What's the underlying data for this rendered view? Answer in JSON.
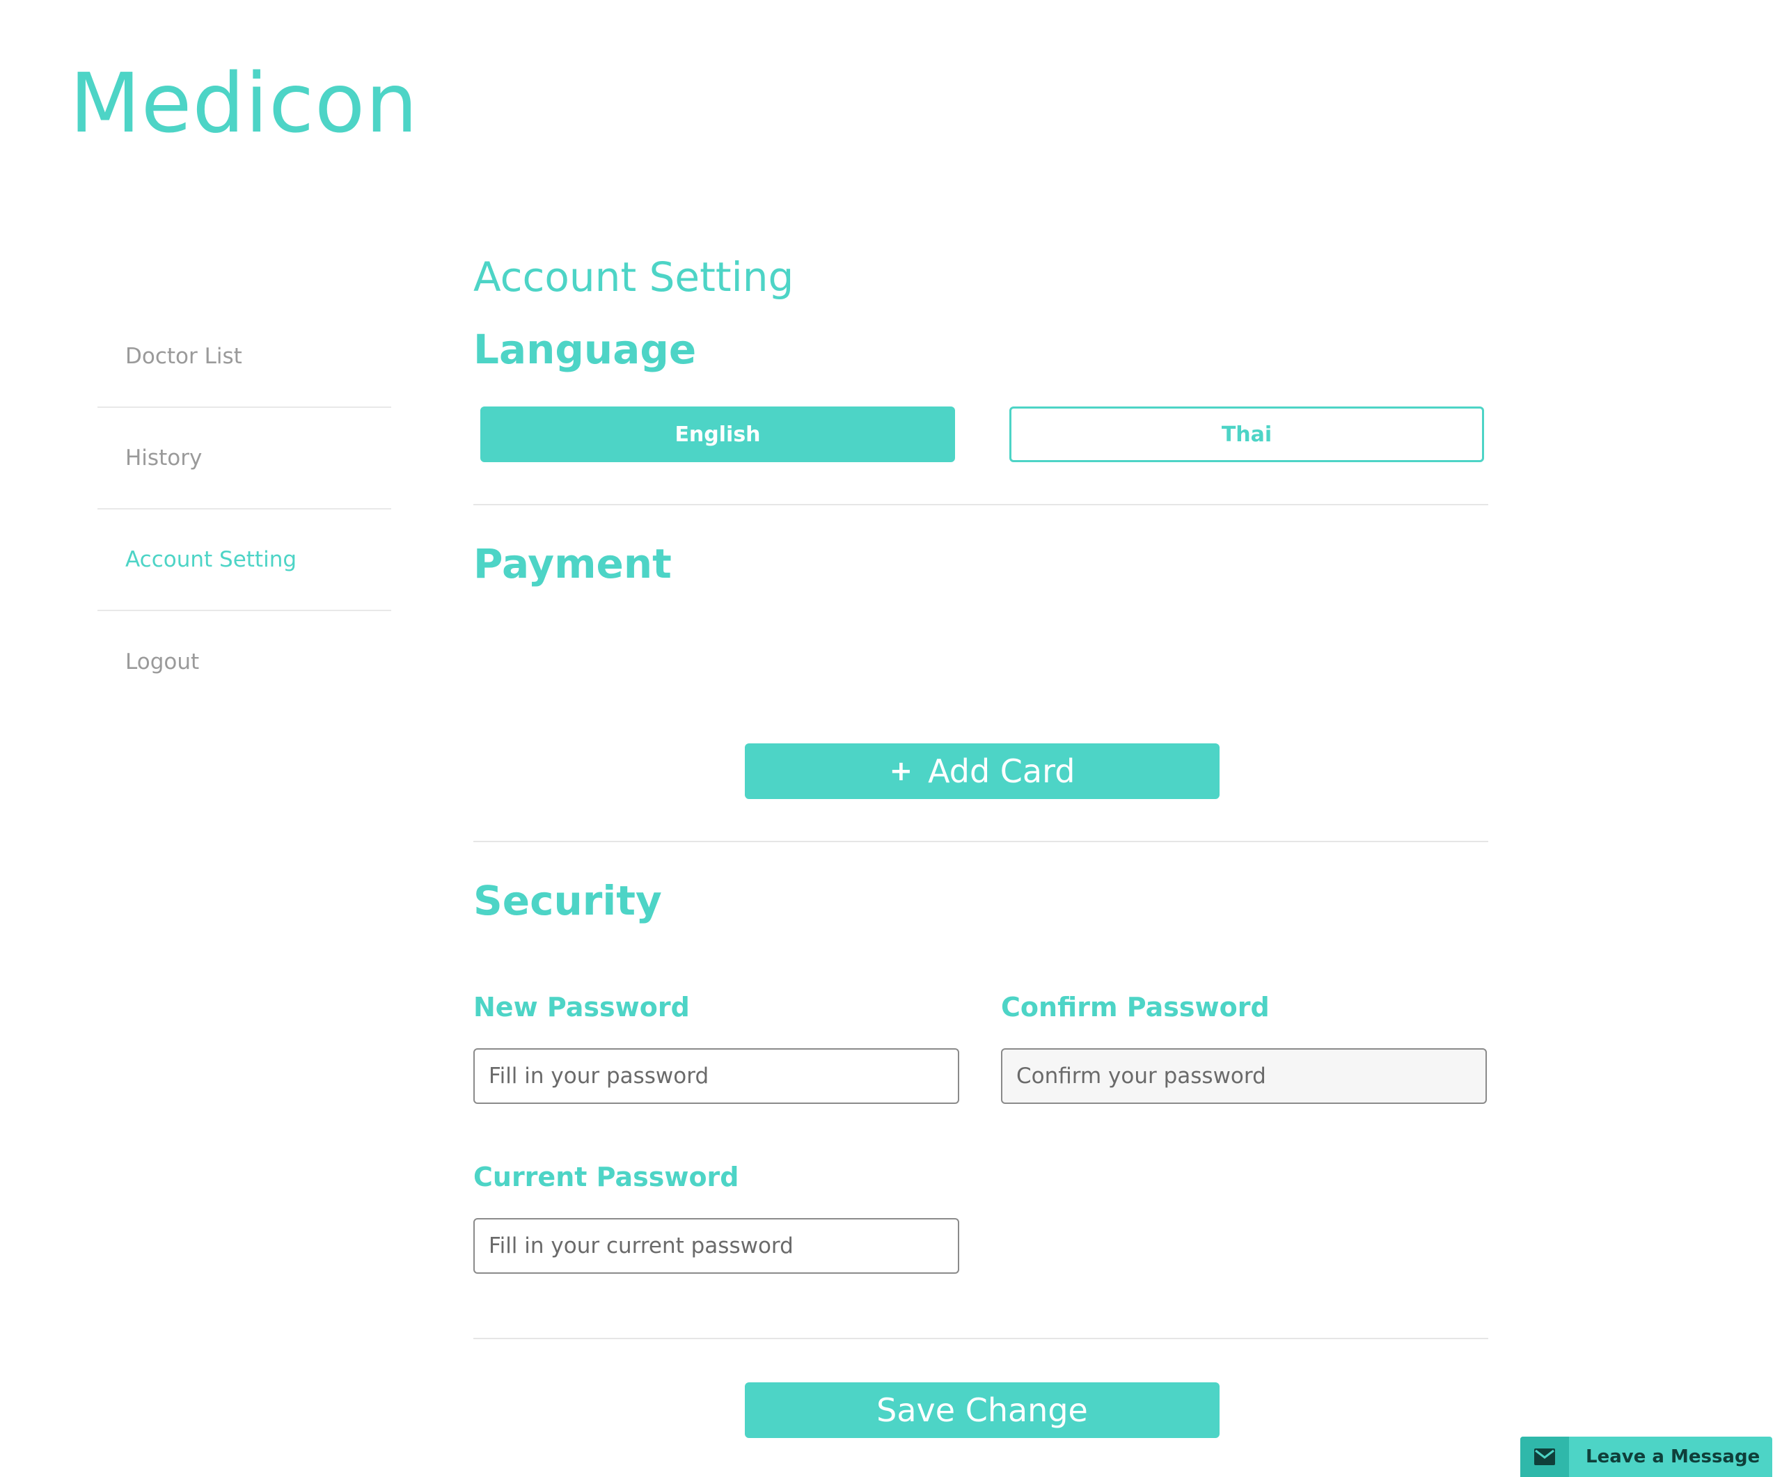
{
  "brand": {
    "name": "Medicon"
  },
  "sidebar": {
    "items": [
      {
        "label": "Doctor List"
      },
      {
        "label": "History"
      },
      {
        "label": "Account Setting"
      },
      {
        "label": "Logout"
      }
    ]
  },
  "main": {
    "title": "Account Setting",
    "language": {
      "heading": "Language",
      "options": [
        "English",
        "Thai"
      ],
      "selected": "English"
    },
    "payment": {
      "heading": "Payment",
      "add_card_plus": "+",
      "add_card_label": "Add Card"
    },
    "security": {
      "heading": "Security",
      "new_password_label": "New Password",
      "new_password_placeholder": "Fill in your password",
      "confirm_password_label": "Confirm Password",
      "confirm_password_placeholder": "Confirm your password",
      "current_password_label": "Current Password",
      "current_password_placeholder": "Fill in your current password"
    },
    "save_label": "Save Change"
  },
  "chat_widget": {
    "label": "Leave a Message",
    "icon": "mail-icon"
  },
  "colors": {
    "accent": "#4dd4c6",
    "muted": "#9a9a9a",
    "divider": "#e6e6e6"
  }
}
